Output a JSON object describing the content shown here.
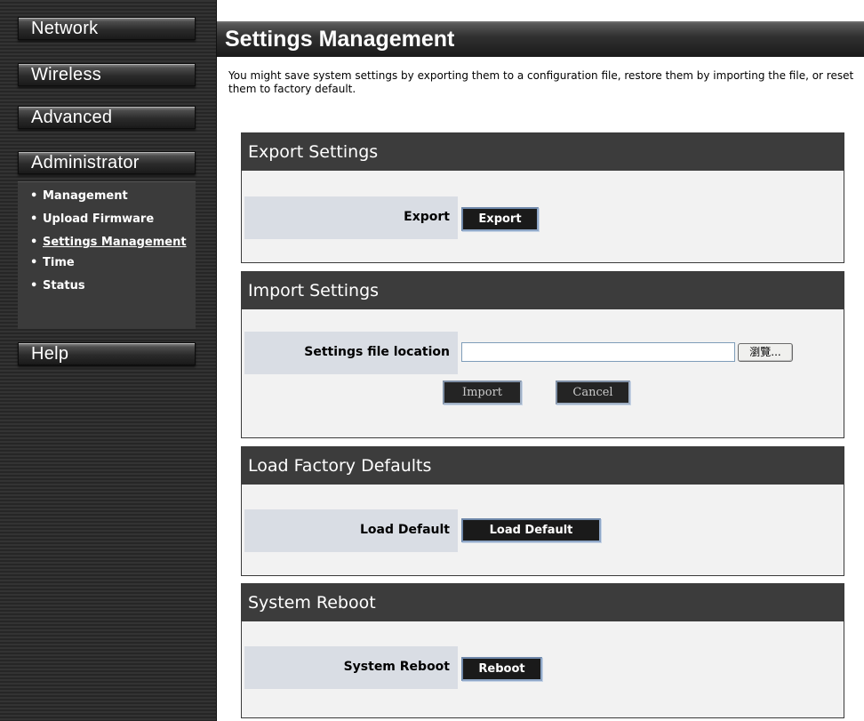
{
  "sidebar": {
    "nav": {
      "network": "Network",
      "wireless": "Wireless",
      "advanced": "Advanced",
      "administrator": "Administrator",
      "help": "Help"
    },
    "submenu": [
      "Management",
      "Upload Firmware",
      "Settings Management",
      "Time",
      "Status"
    ],
    "active_item": "Settings Management"
  },
  "page": {
    "title": "Settings Management",
    "intro": "You might save system settings by exporting them to a configuration file, restore them by importing the file, or reset them to factory default."
  },
  "sections": {
    "export": {
      "title": "Export Settings",
      "label": "Export",
      "button": "Export"
    },
    "import": {
      "title": "Import Settings",
      "label": "Settings file location",
      "file_value": "",
      "browse": "瀏覽...",
      "import_button": "Import",
      "cancel_button": "Cancel"
    },
    "factory": {
      "title": "Load Factory Defaults",
      "label": "Load Default",
      "button": "Load Default"
    },
    "reboot": {
      "title": "System Reboot",
      "label": "System Reboot",
      "button": "Reboot"
    }
  },
  "colors": {
    "sidebar_bg": "#2e2e2e",
    "section_header": "#3c3c3c",
    "row_label_bg": "#d9dde4",
    "button_bg": "#1a1a1a"
  }
}
